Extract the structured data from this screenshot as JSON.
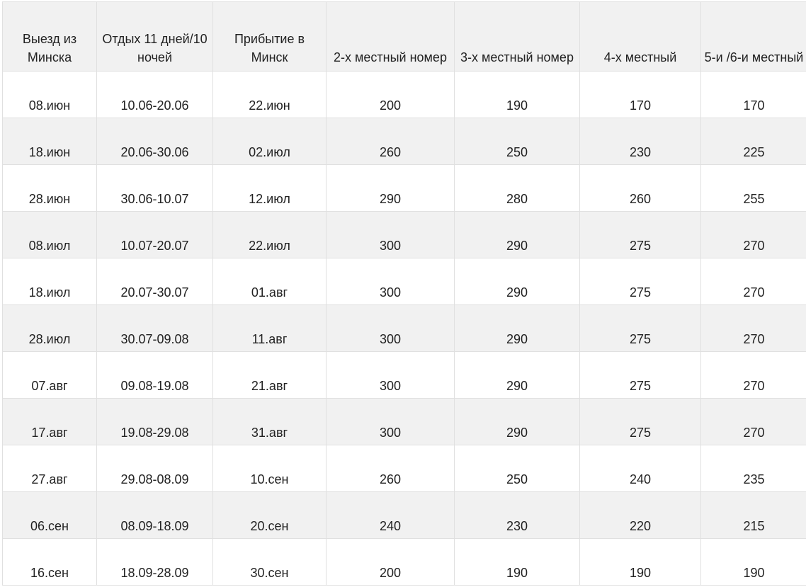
{
  "table": {
    "headers": [
      "Выезд из Минска",
      "Отдых 11 дней/10 ночей",
      "Прибытие в Минск",
      "2-х местный номер",
      "3-х местный номер",
      "4-х местный",
      "5-и /6-и местный"
    ],
    "rows": [
      [
        "08.июн",
        "10.06-20.06",
        "22.июн",
        "200",
        "190",
        "170",
        "170"
      ],
      [
        "18.июн",
        "20.06-30.06",
        "02.июл",
        "260",
        "250",
        "230",
        "225"
      ],
      [
        "28.июн",
        "30.06-10.07",
        "12.июл",
        "290",
        "280",
        "260",
        "255"
      ],
      [
        "08.июл",
        "10.07-20.07",
        "22.июл",
        "300",
        "290",
        "275",
        "270"
      ],
      [
        "18.июл",
        "20.07-30.07",
        "01.авг",
        "300",
        "290",
        "275",
        "270"
      ],
      [
        "28.июл",
        "30.07-09.08",
        "11.авг",
        "300",
        "290",
        "275",
        "270"
      ],
      [
        "07.авг",
        "09.08-19.08",
        "21.авг",
        "300",
        "290",
        "275",
        "270"
      ],
      [
        "17.авг",
        "19.08-29.08",
        "31.авг",
        "300",
        "290",
        "275",
        "270"
      ],
      [
        "27.авг",
        "29.08-08.09",
        "10.сен",
        "260",
        "250",
        "240",
        "235"
      ],
      [
        "06.сен",
        "08.09-18.09",
        "20.сен",
        "240",
        "230",
        "220",
        "215"
      ],
      [
        "16.сен",
        "18.09-28.09",
        "30.сен",
        "200",
        "190",
        "190",
        "190"
      ]
    ]
  }
}
